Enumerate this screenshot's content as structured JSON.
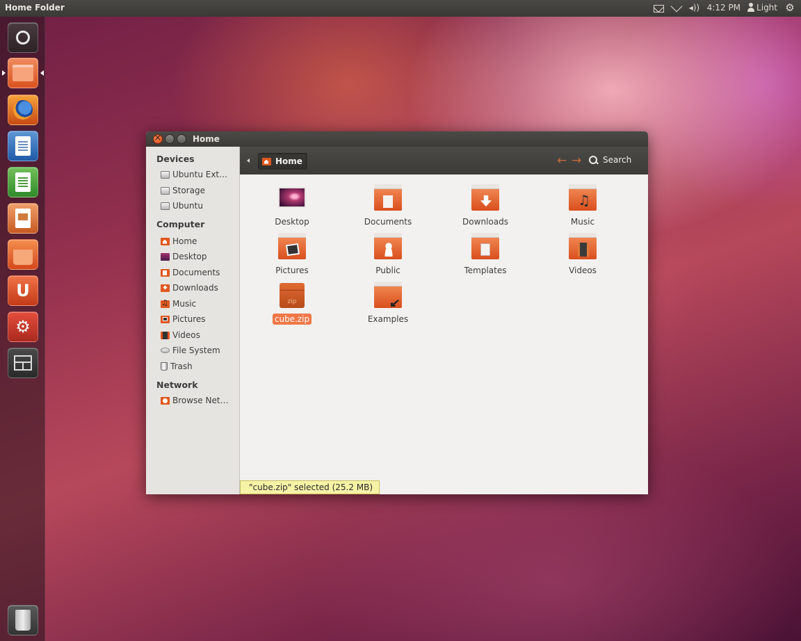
{
  "top_panel": {
    "title": "Home Folder",
    "clock": "4:12 PM",
    "user": "Light"
  },
  "launcher": {
    "items": [
      "dash",
      "files",
      "firefox",
      "libreoffice-writer",
      "libreoffice-calc",
      "libreoffice-impress",
      "software-center",
      "ubuntu-one",
      "system-settings",
      "workspace-switcher",
      "trash"
    ],
    "ubuntuone_glyph": "U",
    "settings_glyph": "⚙"
  },
  "window": {
    "title": "Home",
    "sidebar": {
      "devices_header": "Devices",
      "devices": [
        "Ubuntu Ext…",
        "Storage",
        "Ubuntu"
      ],
      "computer_header": "Computer",
      "computer": [
        "Home",
        "Desktop",
        "Documents",
        "Downloads",
        "Music",
        "Pictures",
        "Videos",
        "File System",
        "Trash"
      ],
      "network_header": "Network",
      "network": [
        "Browse Net…"
      ]
    },
    "toolbar": {
      "breadcrumb": "Home",
      "back_arrow": "←",
      "forward_arrow": "→",
      "search_label": "Search"
    },
    "files": [
      {
        "name": "Desktop"
      },
      {
        "name": "Documents"
      },
      {
        "name": "Downloads"
      },
      {
        "name": "Music"
      },
      {
        "name": "Pictures"
      },
      {
        "name": "Public"
      },
      {
        "name": "Templates"
      },
      {
        "name": "Videos"
      },
      {
        "name": "cube.zip",
        "selected": true,
        "badge": "zip"
      },
      {
        "name": "Examples"
      }
    ],
    "status": "\"cube.zip\" selected (25.2 MB)"
  },
  "colors": {
    "accent": "#f07746",
    "folder": "#e0581f",
    "panel": "#3c3b37"
  }
}
